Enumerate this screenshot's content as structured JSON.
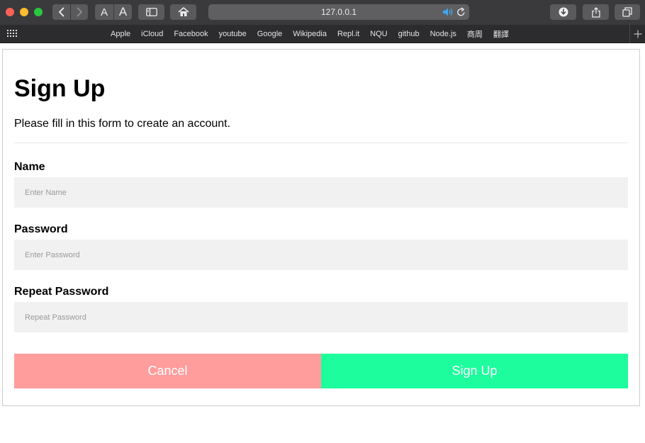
{
  "browser": {
    "address": "127.0.0.1",
    "font_small_label": "A",
    "font_large_label": "A",
    "bookmarks": [
      "Apple",
      "iCloud",
      "Facebook",
      "youtube",
      "Google",
      "Wikipedia",
      "Repl.it",
      "NQU",
      "github",
      "Node.js",
      "商周",
      "翻譯"
    ]
  },
  "form": {
    "title": "Sign Up",
    "subtitle": "Please fill in this form to create an account.",
    "fields": [
      {
        "label": "Name",
        "placeholder": "Enter Name",
        "value": ""
      },
      {
        "label": "Password",
        "placeholder": "Enter Password",
        "value": ""
      },
      {
        "label": "Repeat Password",
        "placeholder": "Repeat Password",
        "value": ""
      }
    ],
    "cancel_label": "Cancel",
    "signup_label": "Sign Up"
  },
  "colors": {
    "cancel_bg": "#ff9d9c",
    "signup_bg": "#1dfd9d",
    "input_bg": "#f1f1f1",
    "chrome_bg": "#3a3a3c",
    "audio_accent": "#3ea7f0"
  },
  "icons": {
    "back": "chevron-left-icon",
    "forward": "chevron-right-icon",
    "sidebar": "sidebar-icon",
    "home": "home-icon",
    "audio": "speaker-icon",
    "reload": "reload-icon",
    "download": "download-icon",
    "share": "share-icon",
    "tabs": "tabs-icon",
    "favorites": "grid-icon",
    "new_tab": "plus-icon"
  }
}
